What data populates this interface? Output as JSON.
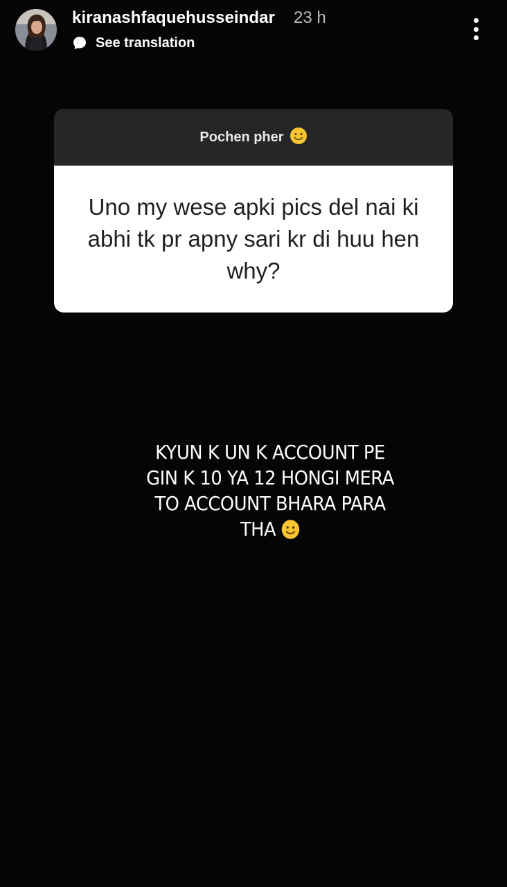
{
  "header": {
    "username": "kiranashfaquehusseindar",
    "time_ago": "23 h",
    "translate_label": "See translation",
    "avatar_icon": "profile-avatar",
    "more_icon": "vertical-dots-icon"
  },
  "question_card": {
    "prompt": "Pochen pher",
    "prompt_emoji": "slightly-smiling-face-emoji",
    "question": "Uno my wese apki pics del nai ki abhi tk pr apny sari kr di huu hen why?",
    "colors": {
      "header_bg": "#262626",
      "body_bg": "#ffffff",
      "question_text": "#1f1f1f"
    }
  },
  "answer": {
    "lines": [
      "KYUN K UN K ACCOUNT PE",
      "GIN K 10 YA 12 HONGI MERA",
      "TO ACCOUNT BHARA PARA",
      "THA"
    ],
    "emoji": "slightly-smiling-face-emoji"
  },
  "colors": {
    "background": "#050505",
    "text": "#ffffff",
    "muted_text": "#bdbdbd",
    "emoji_yellow": "#f7c531"
  }
}
